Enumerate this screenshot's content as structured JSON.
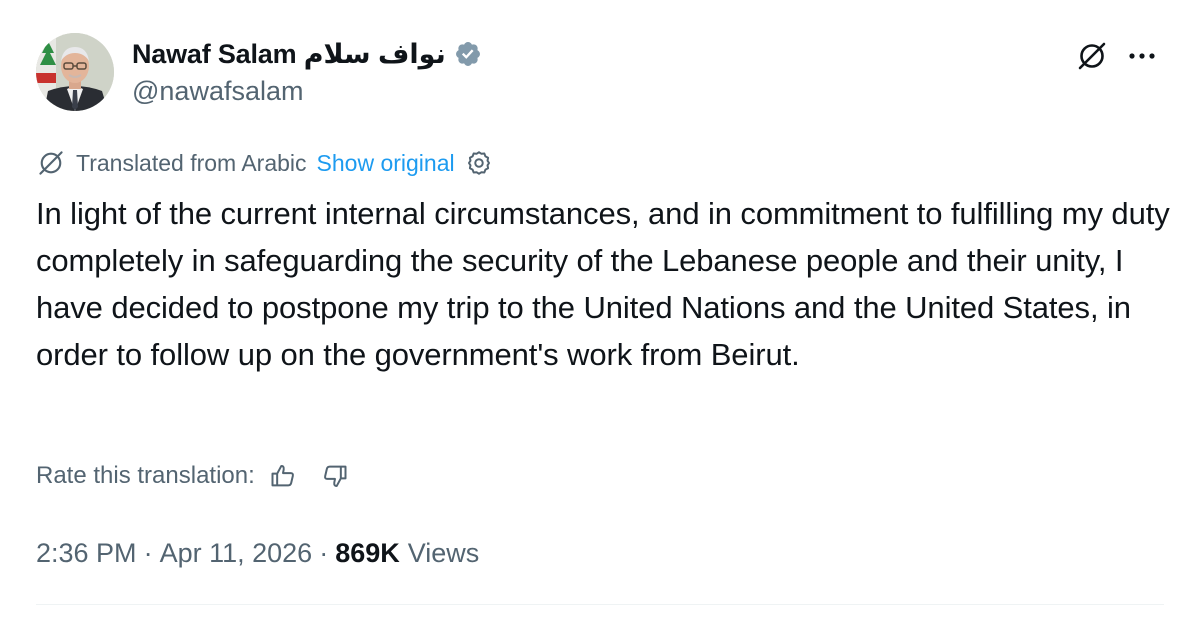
{
  "author": {
    "display_name": "Nawaf Salam نواف سلام",
    "handle": "@nawafsalam",
    "verified": true,
    "verified_badge_color": "#829aab"
  },
  "header_actions": {
    "grok_icon": "grok-icon",
    "more_icon": "more-icon"
  },
  "translation": {
    "label": "Translated from Arabic",
    "show_original": "Show original",
    "settings_icon": "gear-icon"
  },
  "tweet": {
    "text": "In light of the current internal circumstances, and in commitment to fulfilling my duty completely in safeguarding the security of the Lebanese people and their unity, I have decided to postpone my trip to the United Nations and the United States, in order to follow up on the government's work from Beirut."
  },
  "rating": {
    "label": "Rate this translation:",
    "thumbs_up_icon": "thumbs-up-icon",
    "thumbs_down_icon": "thumbs-down-icon"
  },
  "meta": {
    "time": "2:36 PM",
    "separator": "·",
    "date": "Apr 11, 2026",
    "views_count": "869K",
    "views_label": "Views"
  },
  "colors": {
    "text_primary": "#0f1419",
    "text_secondary": "#536471",
    "link": "#1d9bf0",
    "divider": "#eff3f4"
  }
}
